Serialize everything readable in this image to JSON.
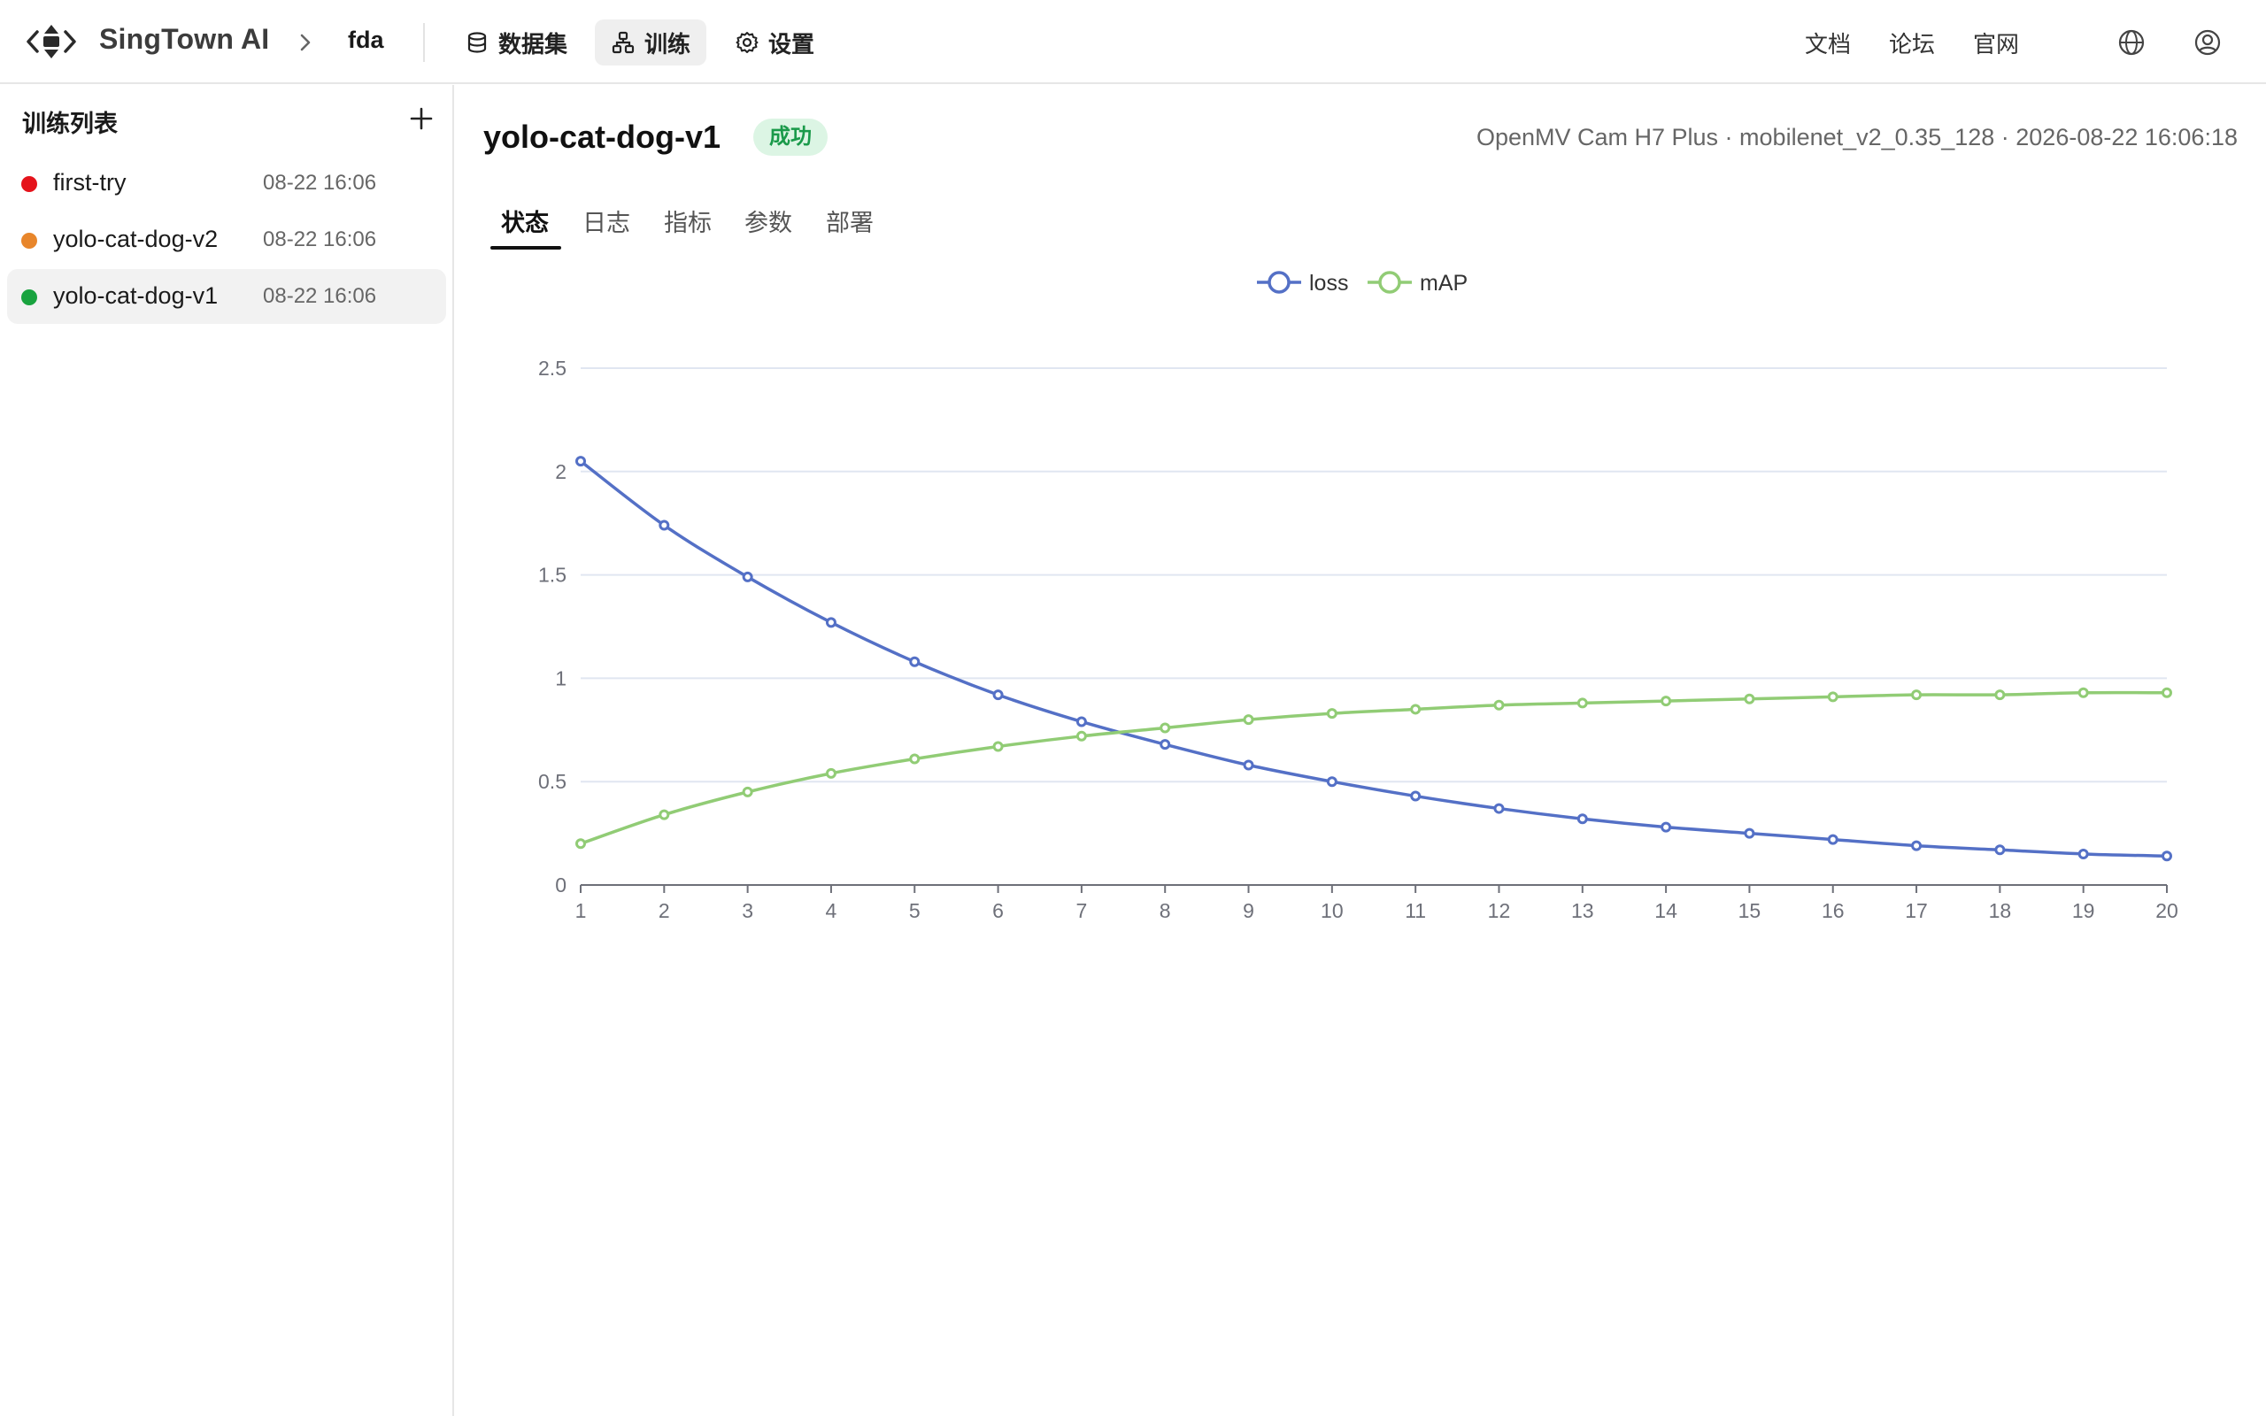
{
  "header": {
    "brand": "SingTown AI",
    "project": "fda",
    "nav": {
      "dataset": "数据集",
      "train": "训练",
      "settings": "设置"
    },
    "links": {
      "docs": "文档",
      "forum": "论坛",
      "website": "官网"
    }
  },
  "sidebar": {
    "title": "训练列表",
    "runs": [
      {
        "name": "first-try",
        "time": "08-22 16:06",
        "status_color": "#e5131b"
      },
      {
        "name": "yolo-cat-dog-v2",
        "time": "08-22 16:06",
        "status_color": "#e8862b"
      },
      {
        "name": "yolo-cat-dog-v1",
        "time": "08-22 16:06",
        "status_color": "#19a33f"
      }
    ]
  },
  "main": {
    "run_name": "yolo-cat-dog-v1",
    "status": "成功",
    "meta": "OpenMV Cam H7 Plus · mobilenet_v2_0.35_128 · 2026-08-22 16:06:18",
    "tabs": [
      "状态",
      "日志",
      "指标",
      "参数",
      "部署"
    ]
  },
  "chart_data": {
    "type": "line",
    "x": [
      1,
      2,
      3,
      4,
      5,
      6,
      7,
      8,
      9,
      10,
      11,
      12,
      13,
      14,
      15,
      16,
      17,
      18,
      19,
      20
    ],
    "xticks": [
      "1",
      "2",
      "3",
      "4",
      "5",
      "6",
      "7",
      "8",
      "9",
      "10",
      "11",
      "12",
      "13",
      "14",
      "15",
      "16",
      "17",
      "18",
      "19",
      "20"
    ],
    "yticks": [
      "0",
      "0.5",
      "1",
      "1.5",
      "2",
      "2.5"
    ],
    "ylim": [
      0,
      2.5
    ],
    "legend_position": "top-center",
    "grid": true,
    "series": [
      {
        "name": "loss",
        "color": "#5470c6",
        "values": [
          2.05,
          1.74,
          1.49,
          1.27,
          1.08,
          0.92,
          0.79,
          0.68,
          0.58,
          0.5,
          0.43,
          0.37,
          0.32,
          0.28,
          0.25,
          0.22,
          0.19,
          0.17,
          0.15,
          0.14
        ]
      },
      {
        "name": "mAP",
        "color": "#91cc75",
        "values": [
          0.2,
          0.34,
          0.45,
          0.54,
          0.61,
          0.67,
          0.72,
          0.76,
          0.8,
          0.83,
          0.85,
          0.87,
          0.88,
          0.89,
          0.9,
          0.91,
          0.92,
          0.92,
          0.93,
          0.93
        ]
      }
    ]
  }
}
